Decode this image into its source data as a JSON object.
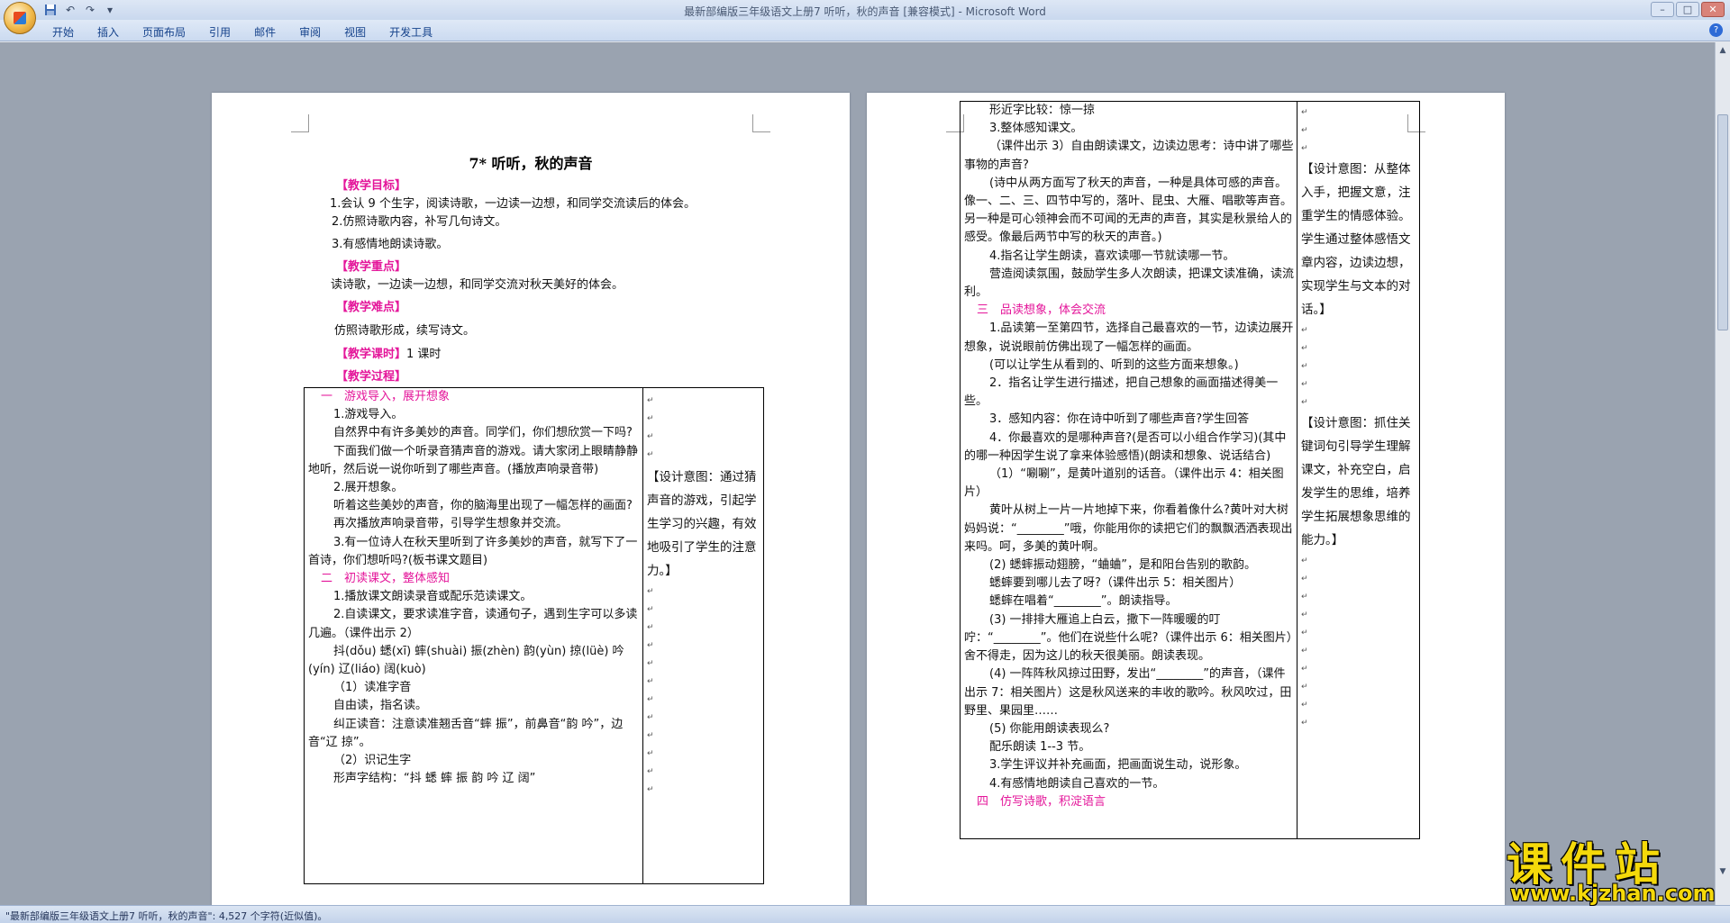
{
  "window": {
    "title": "最新部编版三年级语文上册7 听听，秋的声音 [兼容模式] - Microsoft Word",
    "controls": [
      "–",
      "□",
      "✕"
    ]
  },
  "ribbon": {
    "tabs": [
      "开始",
      "插入",
      "页面布局",
      "引用",
      "邮件",
      "审阅",
      "视图",
      "开发工具"
    ]
  },
  "status": {
    "text": "\"最新部编版三年级语文上册7 听听，秋的声音\": 4,527 个字符(近似值)。"
  },
  "watermark": {
    "main": "课件站",
    "url": "www.kjzhan.com"
  },
  "page1": {
    "title": "7* 听听，秋的声音",
    "goals_head": "【教学目标】",
    "goals": [
      "1.会认 9 个生字，阅读诗歌，一边读一边想，和同学交流读后的体会。",
      "2.仿照诗歌内容，补写几句诗文。",
      "3.有感情地朗读诗歌。"
    ],
    "key_head": "【教学重点】",
    "key": "读诗歌，一边读一边想，和同学交流对秋天美好的体会。",
    "diff_head": "【教学难点】",
    "diff": "仿照诗歌形成，续写诗文。",
    "hours_head": "【教学课时】",
    "hours": "1 课时",
    "process_head": "【教学过程】",
    "table_lines": [
      {
        "t": "一　游戏导入，展开想象",
        "c": "pink",
        "cls": "in2"
      },
      {
        "t": "1.游戏导入。",
        "cls": "in"
      },
      {
        "t": "自然界中有许多美妙的声音。同学们，你们想欣赏一下吗?",
        "cls": "in"
      },
      {
        "t": "下面我们做一个听录音猜声音的游戏。请大家闭上眼睛静静地听，然后说一说你听到了哪些声音。(播放声响录音带)",
        "cls": "in"
      },
      {
        "t": "2.展开想象。",
        "cls": "in"
      },
      {
        "t": "听着这些美妙的声音，你的脑海里出现了一幅怎样的画面?",
        "cls": "in"
      },
      {
        "t": "再次播放声响录音带，引导学生想象并交流。",
        "cls": "in"
      },
      {
        "t": "3.有一位诗人在秋天里听到了许多美妙的声音，就写下了一首诗，你们想听吗?(板书课文题目)",
        "cls": "in"
      },
      {
        "t": "二　初读课文，整体感知",
        "c": "pink",
        "cls": "in2"
      },
      {
        "t": "1.播放课文朗读录音或配乐范读课文。",
        "cls": "in"
      },
      {
        "t": "2.自读课文，要求读准字音，读通句子，遇到生字可以多读几遍。（课件出示 2）",
        "cls": "in"
      },
      {
        "t": "抖(dǒu) 蟋(xī) 蟀(shuài) 振(zhèn) 韵(yùn) 掠(lüè) 吟(yín) 辽(liáo) 阔(kuò)",
        "cls": "in"
      },
      {
        "t": "（1）读准字音",
        "cls": "in"
      },
      {
        "t": "自由读，指名读。",
        "cls": "in"
      },
      {
        "t": "纠正读音：注意读准翘舌音“蟀 振”，前鼻音“韵 吟”，边音“辽 掠”。",
        "cls": "in"
      },
      {
        "t": "（2）识记生字",
        "cls": "in"
      },
      {
        "t": "形声字结构：“抖 蟋 蟀 振 韵 吟 辽 阔”",
        "cls": "in"
      }
    ],
    "side_note": "【设计意图：通过猜声音的游戏，引起学生学习的兴趣，有效地吸引了学生的注意力。】"
  },
  "page2": {
    "table_lines": [
      {
        "t": "形近字比较：惊一掠",
        "cls": "in"
      },
      {
        "t": "3.整体感知课文。",
        "cls": "in"
      },
      {
        "t": "（课件出示 3）自由朗读课文，边读边思考：诗中讲了哪些事物的声音?",
        "cls": "in"
      },
      {
        "t": "(诗中从两方面写了秋天的声音，一种是具体可感的声音。像一、二、三、四节中写的，落叶、昆虫、大雁、唱歌等声音。另一种是可心领神会而不可闻的无声的声音，其实是秋景给人的感受。像最后两节中写的秋天的声音。)",
        "cls": "in"
      },
      {
        "t": "4.指名让学生朗读，喜欢读哪一节就读哪一节。",
        "cls": "in"
      },
      {
        "t": "营造阅读氛围，鼓励学生多人次朗读，把课文读准确，读流利。",
        "cls": "in"
      },
      {
        "t": "三　品读想象，体会交流",
        "c": "pink",
        "cls": "in2"
      },
      {
        "t": "1.品读第一至第四节，选择自己最喜欢的一节，边读边展开想象，说说眼前仿佛出现了一幅怎样的画面。",
        "cls": "in"
      },
      {
        "t": "(可以让学生从看到的、听到的这些方面来想象。)",
        "cls": "in"
      },
      {
        "t": "2．指名让学生进行描述，把自己想象的画面描述得美一些。",
        "cls": "in"
      },
      {
        "t": "3．感知内容：你在诗中听到了哪些声音?学生回答",
        "cls": "in"
      },
      {
        "t": "4．你最喜欢的是哪种声音?(是否可以小组合作学习)(其中的哪一种因学生说了拿来体验感悟)(朗读和想象、说话结合)",
        "cls": "in"
      },
      {
        "t": "（1）“唰唰”，是黄叶道别的话音。（课件出示 4：相关图片）",
        "cls": "in"
      },
      {
        "t": "黄叶从树上一片一片地掉下来，你看着像什么?黄叶对大树妈妈说：“________”哦，你能用你的读把它们的飘飘洒洒表现出来吗。呵，多美的黄叶啊。",
        "cls": "in"
      },
      {
        "t": "(2) 蟋蟀振动翅膀，“蛐蛐”，是和阳台告别的歌韵。",
        "cls": "in"
      },
      {
        "t": "蟋蟀要到哪儿去了呀?（课件出示 5：相关图片）",
        "cls": "in"
      },
      {
        "t": "蟋蟀在唱着“________”。朗读指导。",
        "cls": "in"
      },
      {
        "t": "(3) 一排排大雁追上白云，撒下一阵暖暖的叮咛：“________”。他们在说些什么呢?（课件出示 6：相关图片）舍不得走，因为这儿的秋天很美丽。朗读表现。",
        "cls": "in"
      },
      {
        "t": "(4) 一阵阵秋风掠过田野，发出“________”的声音，（课件出示 7：相关图片）这是秋风送来的丰收的歌吟。秋风吹过，田野里、果园里……",
        "cls": "in"
      },
      {
        "t": "(5) 你能用朗读表现么?",
        "cls": "in"
      },
      {
        "t": "配乐朗读 1--3 节。",
        "cls": "in"
      },
      {
        "t": "3.学生评议并补充画面，把画面说生动，说形象。",
        "cls": "in"
      },
      {
        "t": "4.有感情地朗读自己喜欢的一节。",
        "cls": "in"
      },
      {
        "t": "四　仿写诗歌，积淀语言",
        "c": "pink",
        "cls": "in2"
      }
    ],
    "side_note_1": "【设计意图：从整体入手，把握文意，注重学生的情感体验。学生通过整体感悟文章内容，边读边想，实现学生与文本的对话。】",
    "side_note_2": "【设计意图：抓住关键词句引导学生理解课文，补充空白，启发学生的思维，培养学生拓展想象思维的能力。】",
    "para_mark": "↵"
  }
}
